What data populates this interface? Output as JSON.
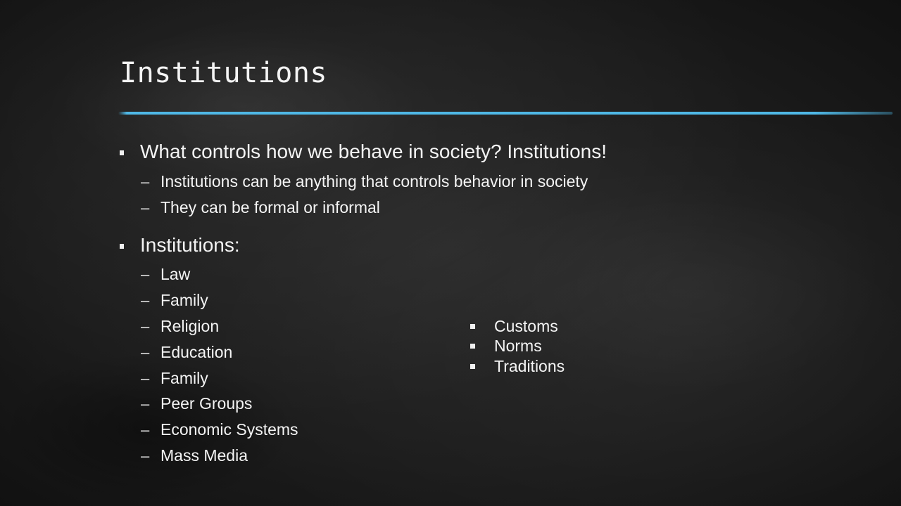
{
  "slide": {
    "title": "Institutions",
    "accent_color": "#4fb8e6",
    "background_color": "#1c1c1c"
  },
  "bullets": [
    {
      "text": "What controls how we behave in society? Institutions!",
      "children": [
        "Institutions can be anything that controls behavior in society",
        "They can be formal or informal"
      ]
    },
    {
      "text": "Institutions:",
      "children": [
        "Law",
        "Family",
        "Religion",
        "Education",
        "Family",
        "Peer Groups",
        "Economic Systems",
        "Mass Media"
      ]
    }
  ],
  "side_list": [
    "Customs",
    "Norms",
    "Traditions"
  ],
  "markers": {
    "level1": "square-bullet-icon",
    "level2": "dash-bullet-icon",
    "side": "square-bullet-icon",
    "dash_char": "–"
  }
}
